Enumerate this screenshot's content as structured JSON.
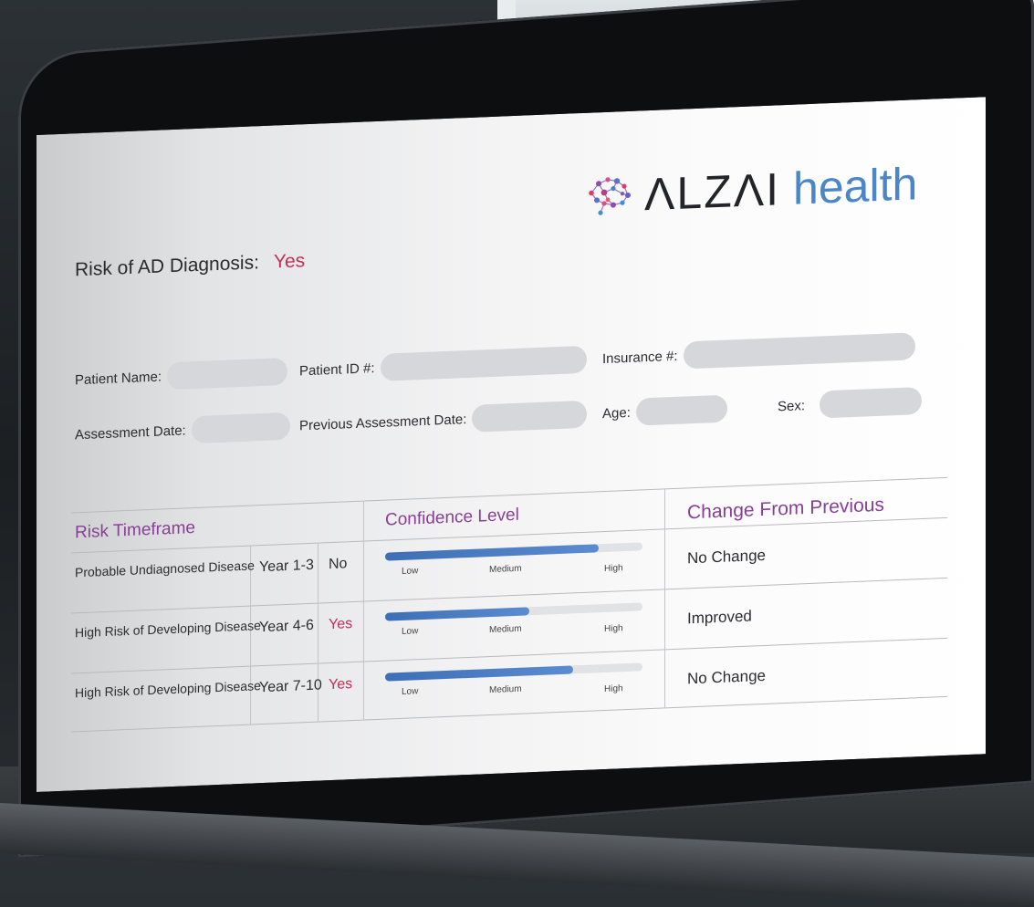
{
  "brand": {
    "name_part1": "ΛLZΛI",
    "name_part2": "health",
    "accent_color": "#4b86c8",
    "alert_color": "#c2305a"
  },
  "risk": {
    "label": "Risk of AD Diagnosis:",
    "value": "Yes"
  },
  "fields": {
    "patient_name": "Patient Name:",
    "patient_id": "Patient ID #:",
    "insurance": "Insurance #:",
    "assessment_date": "Assessment Date:",
    "previous_assessment_date": "Previous Assessment Date:",
    "age": "Age:",
    "sex": "Sex:"
  },
  "table": {
    "headers": {
      "risk_timeframe": "Risk Timeframe",
      "confidence_level": "Confidence Level",
      "change_from_previous": "Change From Previous"
    },
    "bar_labels": {
      "low": "Low",
      "medium": "Medium",
      "high": "High"
    },
    "rows": [
      {
        "category": "Probable Undiagnosed Disease",
        "years": "Year 1-3",
        "flag": "No",
        "confidence": 0.83,
        "change": "No Change"
      },
      {
        "category": "High Risk of Developing Disease",
        "years": "Year 4-6",
        "flag": "Yes",
        "confidence": 0.56,
        "change": "Improved"
      },
      {
        "category": "High Risk of Developing Disease",
        "years": "Year 7-10",
        "flag": "Yes",
        "confidence": 0.73,
        "change": "No Change"
      }
    ]
  }
}
